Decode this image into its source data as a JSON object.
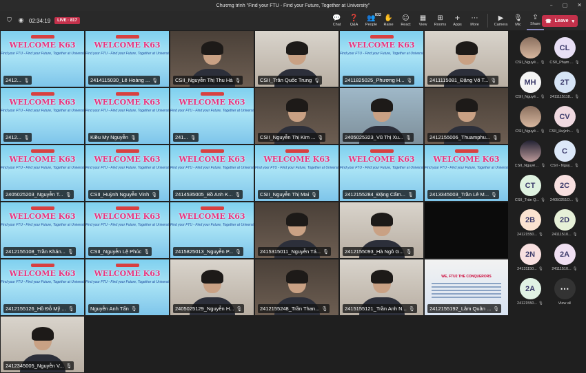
{
  "window": {
    "title": "Chương trình \"Find your FTU - Find your Future, Together at University\""
  },
  "toolbar": {
    "timer": "02:34:19",
    "live_label": "LIVE",
    "live_count": "817",
    "actions": [
      {
        "label": "Chat",
        "icon": "chat-icon",
        "glyph": "💬"
      },
      {
        "label": "Q&A",
        "icon": "qa-icon",
        "glyph": "❓"
      },
      {
        "label": "People",
        "icon": "people-icon",
        "glyph": "👥",
        "count": "832"
      },
      {
        "label": "Raise",
        "icon": "raise-hand-icon",
        "glyph": "✋"
      },
      {
        "label": "React",
        "icon": "react-icon",
        "glyph": "☺"
      },
      {
        "label": "View",
        "icon": "view-icon",
        "glyph": "▦"
      },
      {
        "label": "Rooms",
        "icon": "rooms-icon",
        "glyph": "⊞"
      },
      {
        "label": "Apps",
        "icon": "apps-icon",
        "glyph": "+"
      },
      {
        "label": "More",
        "icon": "more-icon",
        "glyph": "⋯"
      }
    ],
    "camera_label": "Camera",
    "mic_label": "Mic",
    "share_label": "Share",
    "leave_label": "Leave"
  },
  "tiles": [
    {
      "name": "2412...",
      "type": "welcome"
    },
    {
      "name": "2414115030_Lê Hoàng ...",
      "type": "welcome"
    },
    {
      "name": "CSII_Nguyễn Thị Thu Hà",
      "type": "person"
    },
    {
      "name": "CSII_Trần Quốc Trung",
      "type": "person-light"
    },
    {
      "name": "2411825025_Phương H...",
      "type": "welcome"
    },
    {
      "name": "2411115081_Đặng Võ T...",
      "type": "person-light"
    },
    {
      "name": "2412...",
      "type": "welcome"
    },
    {
      "name": "Kiều My Nguyễn",
      "type": "welcome"
    },
    {
      "name": "241...",
      "type": "welcome"
    },
    {
      "name": "CSII_Nguyễn Thị Kim ...",
      "type": "person"
    },
    {
      "name": "2405025323_Vũ Thị Xu...",
      "type": "person-blue"
    },
    {
      "name": "2412155006_Thuamphu...",
      "type": "person"
    },
    {
      "name": "2405025203_Nguyễn T...",
      "type": "welcome"
    },
    {
      "name": "CSII_Huỳnh Nguyễn Vinh",
      "type": "welcome"
    },
    {
      "name": "2414535005_Bồ Anh K...",
      "type": "welcome"
    },
    {
      "name": "CSII_Nguyễn Thị Mai",
      "type": "welcome"
    },
    {
      "name": "2412155284_Đặng Cẩm...",
      "type": "welcome"
    },
    {
      "name": "2413345003_Trần Lê M...",
      "type": "welcome"
    },
    {
      "name": "2412155108_Trần Khán...",
      "type": "welcome"
    },
    {
      "name": "CSII_Nguyễn Lệ Phúc",
      "type": "welcome"
    },
    {
      "name": "2415825013_Nguyễn P...",
      "type": "welcome"
    },
    {
      "name": "2415315011_Nguyễn Tá...",
      "type": "person"
    },
    {
      "name": "2412155093_Hà Ngô G...",
      "type": "person-light"
    },
    {
      "name": "",
      "type": "black"
    },
    {
      "name": "2412155126_Hồ Đỗ Mỹ ...",
      "type": "welcome"
    },
    {
      "name": "Nguyễn Anh Tấn",
      "type": "welcome"
    },
    {
      "name": "2405025129_Nguyễn H...",
      "type": "person-light"
    },
    {
      "name": "2412155248_Trần Than...",
      "type": "person"
    },
    {
      "name": "2415155121_Trần Anh N...",
      "type": "person-light"
    },
    {
      "name": "2412155192_Lâm Quân ...",
      "type": "poster"
    },
    {
      "name": "2412345005_Nguyễn V...",
      "type": "person-light"
    }
  ],
  "poster_text": "WE, FTU2 THE CONQUERORS",
  "welcome_text": "WELCOME K63",
  "welcome_sub": "Find your FTU - Find your Future, Together at University",
  "participants": [
    {
      "initials": "",
      "name": "CSII_Nguyễ...",
      "color": "photo"
    },
    {
      "initials": "CL",
      "name": "CSII_Phạm ...",
      "color": "#e8dff5"
    },
    {
      "initials": "MH",
      "name": "CSII_Nguyễ...",
      "color": "#f5f5f5"
    },
    {
      "initials": "2T",
      "name": "2411115118...",
      "color": "#d6e4f5"
    },
    {
      "initials": "",
      "name": "CSII_Nguyễ...",
      "color": "photo"
    },
    {
      "initials": "CV",
      "name": "CSII_Huỳnh Ng...",
      "color": "#f0d9e0"
    },
    {
      "initials": "",
      "name": "CSII_Nguyễn Th...",
      "color": "photo2"
    },
    {
      "initials": "C",
      "name": "CSII - Nguy...",
      "color": "#dce8f8"
    },
    {
      "initials": "CT",
      "name": "CSII_Trần Q...",
      "color": "#dff2e0"
    },
    {
      "initials": "2C",
      "name": "24050251O...",
      "color": "#f8e0e0"
    },
    {
      "initials": "2B",
      "name": "24121550...",
      "color": "#fbe3d0"
    },
    {
      "initials": "2D",
      "name": "24111510...",
      "color": "#e6f0d8"
    },
    {
      "initials": "2N",
      "name": "24131150...",
      "color": "#f8e0e0"
    },
    {
      "initials": "2A",
      "name": "24111510...",
      "color": "#f0e0f2"
    },
    {
      "initials": "2A",
      "name": "24121550...",
      "color": "#e0f2e4"
    },
    {
      "initials": "⋯",
      "name": "View all",
      "color": "viewall"
    }
  ]
}
